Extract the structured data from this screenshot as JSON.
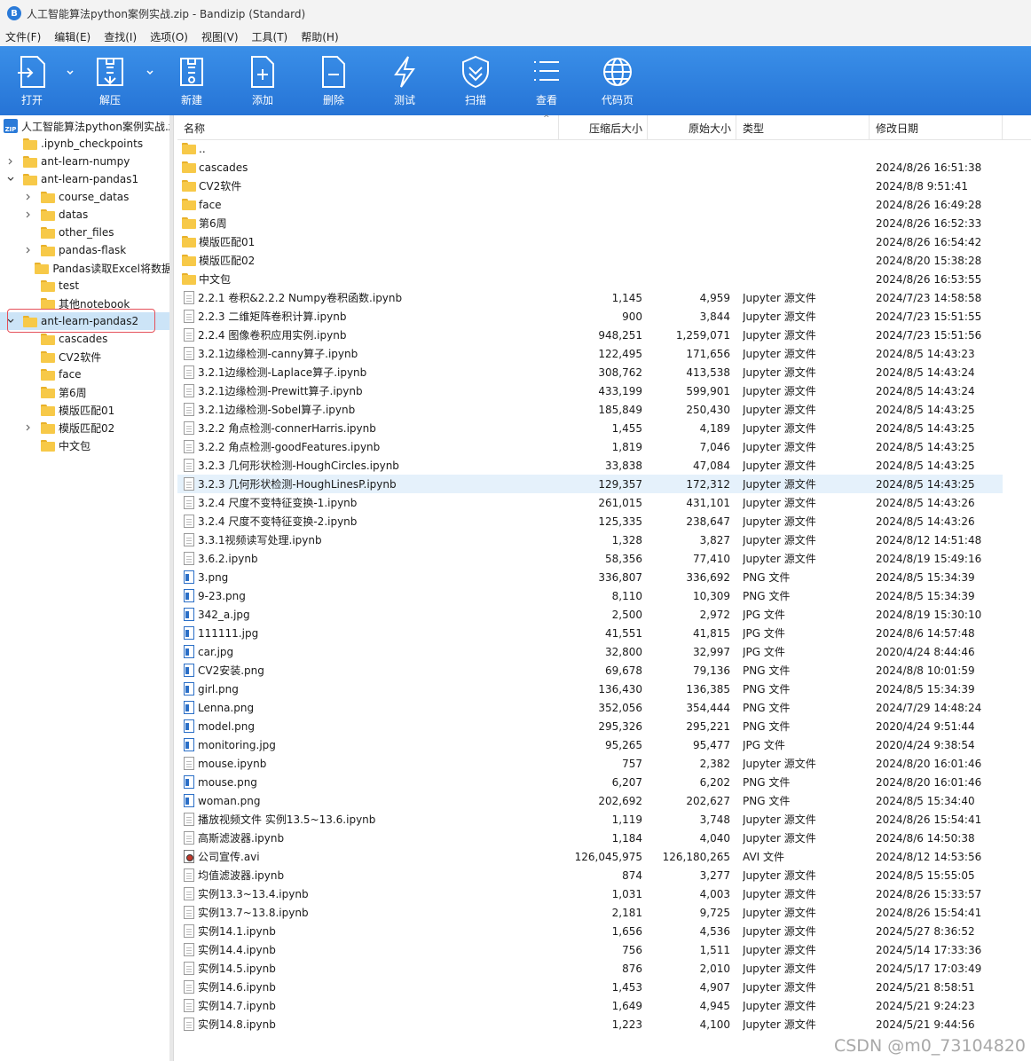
{
  "window": {
    "title": "人工智能算法python案例实战.zip - Bandizip (Standard)"
  },
  "menu": [
    "文件(F)",
    "编辑(E)",
    "查找(I)",
    "选项(O)",
    "视图(V)",
    "工具(T)",
    "帮助(H)"
  ],
  "toolbar": {
    "open": "打开",
    "extract": "解压",
    "new": "新建",
    "add": "添加",
    "delete": "删除",
    "test": "测试",
    "scan": "扫描",
    "view": "查看",
    "codepage": "代码页"
  },
  "tree": {
    "root": "人工智能算法python案例实战.zip",
    "items": [
      {
        "label": ".ipynb_checkpoints",
        "arrow": "",
        "level": 1
      },
      {
        "label": "ant-learn-numpy",
        "arrow": "collapsed",
        "level": 1
      },
      {
        "label": "ant-learn-pandas1",
        "arrow": "expanded",
        "level": 1
      },
      {
        "label": "course_datas",
        "arrow": "collapsed",
        "level": 2
      },
      {
        "label": "datas",
        "arrow": "collapsed",
        "level": 2
      },
      {
        "label": "other_files",
        "arrow": "",
        "level": 2
      },
      {
        "label": "pandas-flask",
        "arrow": "collapsed",
        "level": 2
      },
      {
        "label": "Pandas读取Excel将数据",
        "arrow": "",
        "level": 2
      },
      {
        "label": "test",
        "arrow": "",
        "level": 2
      },
      {
        "label": "其他notebook",
        "arrow": "",
        "level": 2
      },
      {
        "label": "ant-learn-pandas2",
        "arrow": "expanded",
        "level": 1,
        "selected": true
      },
      {
        "label": "cascades",
        "arrow": "",
        "level": 2
      },
      {
        "label": "CV2软件",
        "arrow": "",
        "level": 2
      },
      {
        "label": "face",
        "arrow": "",
        "level": 2
      },
      {
        "label": "第6周",
        "arrow": "",
        "level": 2
      },
      {
        "label": "模版匹配01",
        "arrow": "",
        "level": 2
      },
      {
        "label": "模版匹配02",
        "arrow": "collapsed",
        "level": 2
      },
      {
        "label": "中文包",
        "arrow": "",
        "level": 2
      }
    ]
  },
  "columns": {
    "name": "名称",
    "compressed": "压缩后大小",
    "original": "原始大小",
    "type": "类型",
    "modified": "修改日期"
  },
  "files": [
    {
      "icon": "folder",
      "name": "..",
      "comp": "",
      "orig": "",
      "type": "",
      "date": ""
    },
    {
      "icon": "folder",
      "name": "cascades",
      "comp": "",
      "orig": "",
      "type": "",
      "date": "2024/8/26 16:51:38"
    },
    {
      "icon": "folder",
      "name": "CV2软件",
      "comp": "",
      "orig": "",
      "type": "",
      "date": "2024/8/8 9:51:41"
    },
    {
      "icon": "folder",
      "name": "face",
      "comp": "",
      "orig": "",
      "type": "",
      "date": "2024/8/26 16:49:28"
    },
    {
      "icon": "folder",
      "name": "第6周",
      "comp": "",
      "orig": "",
      "type": "",
      "date": "2024/8/26 16:52:33"
    },
    {
      "icon": "folder",
      "name": "模版匹配01",
      "comp": "",
      "orig": "",
      "type": "",
      "date": "2024/8/26 16:54:42"
    },
    {
      "icon": "folder",
      "name": "模版匹配02",
      "comp": "",
      "orig": "",
      "type": "",
      "date": "2024/8/20 15:38:28"
    },
    {
      "icon": "folder",
      "name": "中文包",
      "comp": "",
      "orig": "",
      "type": "",
      "date": "2024/8/26 16:53:55"
    },
    {
      "icon": "doc",
      "name": "2.2.1 卷积&2.2.2 Numpy卷积函数.ipynb",
      "comp": "1,145",
      "orig": "4,959",
      "type": "Jupyter 源文件",
      "date": "2024/7/23 14:58:58"
    },
    {
      "icon": "doc",
      "name": "2.2.3 二维矩阵卷积计算.ipynb",
      "comp": "900",
      "orig": "3,844",
      "type": "Jupyter 源文件",
      "date": "2024/7/23 15:51:55"
    },
    {
      "icon": "doc",
      "name": "2.2.4 图像卷积应用实例.ipynb",
      "comp": "948,251",
      "orig": "1,259,071",
      "type": "Jupyter 源文件",
      "date": "2024/7/23 15:51:56"
    },
    {
      "icon": "doc",
      "name": "3.2.1边缘检测-canny算子.ipynb",
      "comp": "122,495",
      "orig": "171,656",
      "type": "Jupyter 源文件",
      "date": "2024/8/5 14:43:23"
    },
    {
      "icon": "doc",
      "name": "3.2.1边缘检测-Laplace算子.ipynb",
      "comp": "308,762",
      "orig": "413,538",
      "type": "Jupyter 源文件",
      "date": "2024/8/5 14:43:24"
    },
    {
      "icon": "doc",
      "name": "3.2.1边缘检测-Prewitt算子.ipynb",
      "comp": "433,199",
      "orig": "599,901",
      "type": "Jupyter 源文件",
      "date": "2024/8/5 14:43:24"
    },
    {
      "icon": "doc",
      "name": "3.2.1边缘检测-Sobel算子.ipynb",
      "comp": "185,849",
      "orig": "250,430",
      "type": "Jupyter 源文件",
      "date": "2024/8/5 14:43:25"
    },
    {
      "icon": "doc",
      "name": "3.2.2 角点检测-connerHarris.ipynb",
      "comp": "1,455",
      "orig": "4,189",
      "type": "Jupyter 源文件",
      "date": "2024/8/5 14:43:25"
    },
    {
      "icon": "doc",
      "name": "3.2.2 角点检测-goodFeatures.ipynb",
      "comp": "1,819",
      "orig": "7,046",
      "type": "Jupyter 源文件",
      "date": "2024/8/5 14:43:25"
    },
    {
      "icon": "doc",
      "name": "3.2.3 几何形状检测-HoughCircles.ipynb",
      "comp": "33,838",
      "orig": "47,084",
      "type": "Jupyter 源文件",
      "date": "2024/8/5 14:43:25"
    },
    {
      "icon": "doc",
      "name": "3.2.3 几何形状检测-HoughLinesP.ipynb",
      "comp": "129,357",
      "orig": "172,312",
      "type": "Jupyter 源文件",
      "date": "2024/8/5 14:43:25",
      "hover": true
    },
    {
      "icon": "doc",
      "name": "3.2.4 尺度不变特征变换-1.ipynb",
      "comp": "261,015",
      "orig": "431,101",
      "type": "Jupyter 源文件",
      "date": "2024/8/5 14:43:26"
    },
    {
      "icon": "doc",
      "name": "3.2.4 尺度不变特征变换-2.ipynb",
      "comp": "125,335",
      "orig": "238,647",
      "type": "Jupyter 源文件",
      "date": "2024/8/5 14:43:26"
    },
    {
      "icon": "doc",
      "name": "3.3.1视频读写处理.ipynb",
      "comp": "1,328",
      "orig": "3,827",
      "type": "Jupyter 源文件",
      "date": "2024/8/12 14:51:48"
    },
    {
      "icon": "doc",
      "name": "3.6.2.ipynb",
      "comp": "58,356",
      "orig": "77,410",
      "type": "Jupyter 源文件",
      "date": "2024/8/19 15:49:16"
    },
    {
      "icon": "img",
      "name": "3.png",
      "comp": "336,807",
      "orig": "336,692",
      "type": "PNG 文件",
      "date": "2024/8/5 15:34:39"
    },
    {
      "icon": "img",
      "name": "9-23.png",
      "comp": "8,110",
      "orig": "10,309",
      "type": "PNG 文件",
      "date": "2024/8/5 15:34:39"
    },
    {
      "icon": "img",
      "name": "342_a.jpg",
      "comp": "2,500",
      "orig": "2,972",
      "type": "JPG 文件",
      "date": "2024/8/19 15:30:10"
    },
    {
      "icon": "img",
      "name": "111111.jpg",
      "comp": "41,551",
      "orig": "41,815",
      "type": "JPG 文件",
      "date": "2024/8/6 14:57:48"
    },
    {
      "icon": "img",
      "name": "car.jpg",
      "comp": "32,800",
      "orig": "32,997",
      "type": "JPG 文件",
      "date": "2020/4/24 8:44:46"
    },
    {
      "icon": "img",
      "name": "CV2安装.png",
      "comp": "69,678",
      "orig": "79,136",
      "type": "PNG 文件",
      "date": "2024/8/8 10:01:59"
    },
    {
      "icon": "img",
      "name": "girl.png",
      "comp": "136,430",
      "orig": "136,385",
      "type": "PNG 文件",
      "date": "2024/8/5 15:34:39"
    },
    {
      "icon": "img",
      "name": "Lenna.png",
      "comp": "352,056",
      "orig": "354,444",
      "type": "PNG 文件",
      "date": "2024/7/29 14:48:24"
    },
    {
      "icon": "img",
      "name": "model.png",
      "comp": "295,326",
      "orig": "295,221",
      "type": "PNG 文件",
      "date": "2020/4/24 9:51:44"
    },
    {
      "icon": "img",
      "name": "monitoring.jpg",
      "comp": "95,265",
      "orig": "95,477",
      "type": "JPG 文件",
      "date": "2020/4/24 9:38:54"
    },
    {
      "icon": "doc",
      "name": "mouse.ipynb",
      "comp": "757",
      "orig": "2,382",
      "type": "Jupyter 源文件",
      "date": "2024/8/20 16:01:46"
    },
    {
      "icon": "img",
      "name": "mouse.png",
      "comp": "6,207",
      "orig": "6,202",
      "type": "PNG 文件",
      "date": "2024/8/20 16:01:46"
    },
    {
      "icon": "img",
      "name": "woman.png",
      "comp": "202,692",
      "orig": "202,627",
      "type": "PNG 文件",
      "date": "2024/8/5 15:34:40"
    },
    {
      "icon": "doc",
      "name": "播放视频文件 实例13.5~13.6.ipynb",
      "comp": "1,119",
      "orig": "3,748",
      "type": "Jupyter 源文件",
      "date": "2024/8/26 15:54:41"
    },
    {
      "icon": "doc",
      "name": "高斯滤波器.ipynb",
      "comp": "1,184",
      "orig": "4,040",
      "type": "Jupyter 源文件",
      "date": "2024/8/6 14:50:38"
    },
    {
      "icon": "avi",
      "name": "公司宣传.avi",
      "comp": "126,045,975",
      "orig": "126,180,265",
      "type": "AVI 文件",
      "date": "2024/8/12 14:53:56"
    },
    {
      "icon": "doc",
      "name": "均值滤波器.ipynb",
      "comp": "874",
      "orig": "3,277",
      "type": "Jupyter 源文件",
      "date": "2024/8/5 15:55:05"
    },
    {
      "icon": "doc",
      "name": "实例13.3~13.4.ipynb",
      "comp": "1,031",
      "orig": "4,003",
      "type": "Jupyter 源文件",
      "date": "2024/8/26 15:33:57"
    },
    {
      "icon": "doc",
      "name": "实例13.7~13.8.ipynb",
      "comp": "2,181",
      "orig": "9,725",
      "type": "Jupyter 源文件",
      "date": "2024/8/26 15:54:41"
    },
    {
      "icon": "doc",
      "name": "实例14.1.ipynb",
      "comp": "1,656",
      "orig": "4,536",
      "type": "Jupyter 源文件",
      "date": "2024/5/27 8:36:52"
    },
    {
      "icon": "doc",
      "name": "实例14.4.ipynb",
      "comp": "756",
      "orig": "1,511",
      "type": "Jupyter 源文件",
      "date": "2024/5/14 17:33:36"
    },
    {
      "icon": "doc",
      "name": "实例14.5.ipynb",
      "comp": "876",
      "orig": "2,010",
      "type": "Jupyter 源文件",
      "date": "2024/5/17 17:03:49"
    },
    {
      "icon": "doc",
      "name": "实例14.6.ipynb",
      "comp": "1,453",
      "orig": "4,907",
      "type": "Jupyter 源文件",
      "date": "2024/5/21 8:58:51"
    },
    {
      "icon": "doc",
      "name": "实例14.7.ipynb",
      "comp": "1,649",
      "orig": "4,945",
      "type": "Jupyter 源文件",
      "date": "2024/5/21 9:24:23"
    },
    {
      "icon": "doc",
      "name": "实例14.8.ipynb",
      "comp": "1,223",
      "orig": "4,100",
      "type": "Jupyter 源文件",
      "date": "2024/5/21 9:44:56"
    }
  ],
  "watermark": "CSDN @m0_73104820",
  "colors": {
    "toolbar": "#2674d6",
    "selection": "#cce4f7",
    "hover": "#e5f1fb",
    "highlight_box": "#e5505a",
    "folder": "#f7c948"
  }
}
